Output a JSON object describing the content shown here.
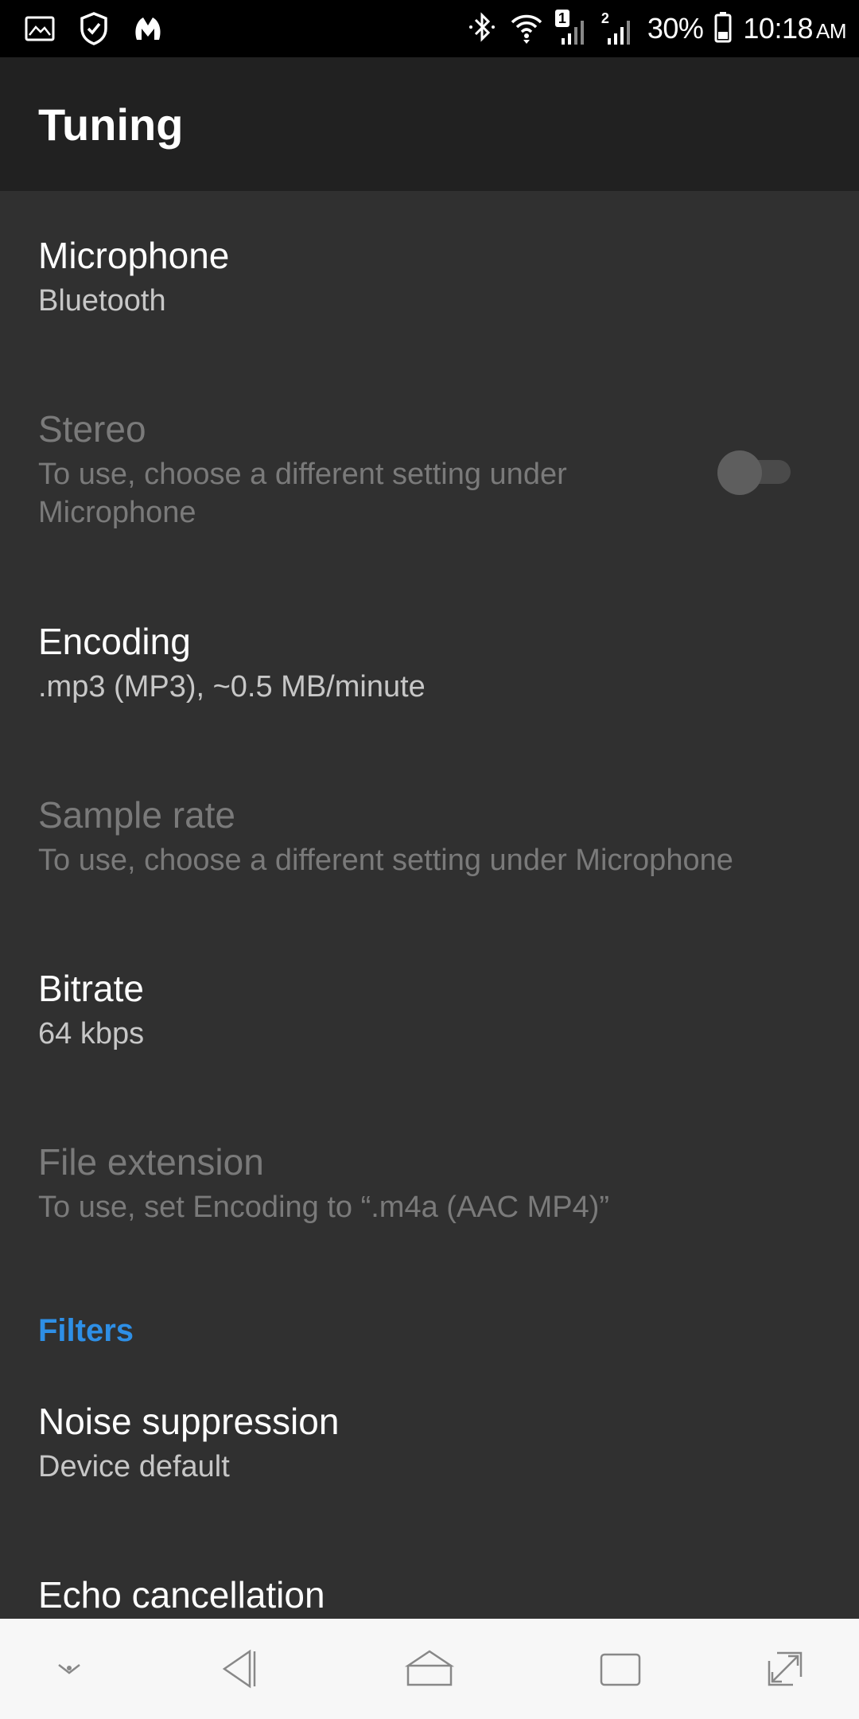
{
  "status_bar": {
    "battery": "30%",
    "time": "10:18",
    "ampm": "AM",
    "sim1_label": "1",
    "sim2_label": "2",
    "icons": [
      "image-icon",
      "shield-icon",
      "malwarebytes-icon",
      "bluetooth-icon",
      "wifi-icon",
      "signal-icon",
      "signal-icon",
      "battery-icon"
    ]
  },
  "app_bar": {
    "title": "Tuning"
  },
  "preferences": [
    {
      "title": "Microphone",
      "summary": "Bluetooth",
      "enabled": true
    },
    {
      "title": "Stereo",
      "summary": "To use, choose a different setting under Microphone",
      "enabled": false,
      "switch": false
    },
    {
      "title": "Encoding",
      "summary": ".mp3 (MP3), ~0.5 MB/minute",
      "enabled": true
    },
    {
      "title": "Sample rate",
      "summary": "To use, choose a different setting under Microphone",
      "enabled": false
    },
    {
      "title": "Bitrate",
      "summary": "64 kbps",
      "enabled": true
    },
    {
      "title": "File extension",
      "summary": "To use, set Encoding to “.m4a (AAC MP4)”",
      "enabled": false
    }
  ],
  "filters": {
    "header": "Filters",
    "items": [
      {
        "title": "Noise suppression",
        "summary": "Device default",
        "enabled": true
      },
      {
        "title": "Echo cancellation",
        "summary": "",
        "enabled": true
      }
    ]
  },
  "nav_bar": {
    "icons": [
      "chevron-down-icon",
      "back-icon",
      "home-icon",
      "recents-icon",
      "expand-icon"
    ]
  },
  "colors": {
    "accent": "#2e8fe6",
    "background": "#303030",
    "app_bar": "#212121",
    "status_bar": "#000000",
    "nav_bar": "#f7f7f7"
  }
}
